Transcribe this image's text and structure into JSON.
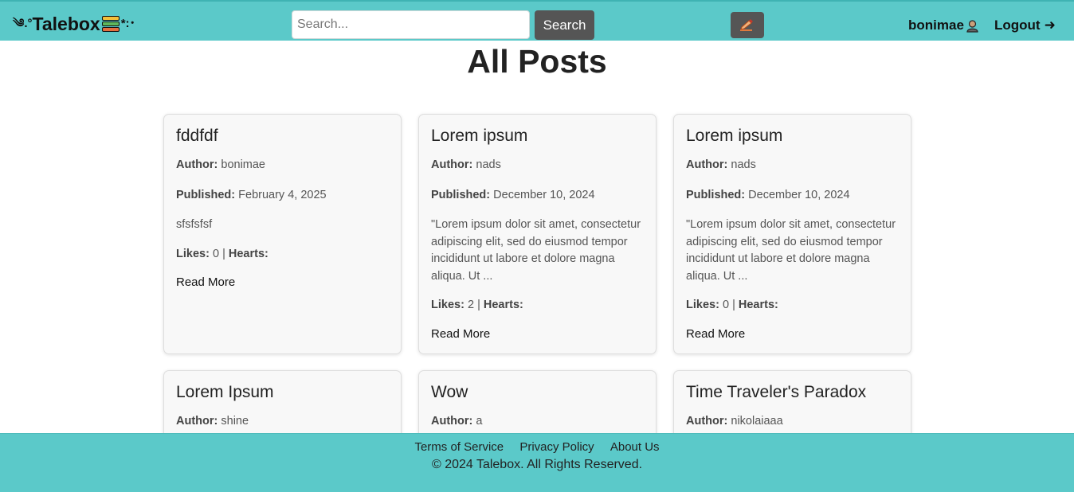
{
  "navbar": {
    "brand_prefix": "༄.°",
    "brand_name": "Talebox",
    "brand_suffix": "*:･",
    "search_placeholder": "Search...",
    "search_value": "",
    "search_label": "Search",
    "username": "bonimae",
    "logout_label": "Logout",
    "logout_arrow": "➜"
  },
  "main": {
    "title": "All Posts",
    "labels": {
      "author": "Author:",
      "published": "Published:",
      "likes": "Likes:",
      "hearts": "Hearts:",
      "read_more": "Read More",
      "separator": "|"
    },
    "posts": [
      {
        "title": "fddfdf",
        "author": "bonimae",
        "published": "February 4, 2025",
        "excerpt": "sfsfsfsf",
        "likes": "0",
        "hearts": ""
      },
      {
        "title": "Lorem ipsum",
        "author": "nads",
        "published": "December 10, 2024",
        "excerpt": "\"Lorem ipsum dolor sit amet, consectetur adipiscing elit, sed do eiusmod tempor incididunt ut labore et dolore magna aliqua. Ut ...",
        "likes": "2",
        "hearts": ""
      },
      {
        "title": "Lorem ipsum",
        "author": "nads",
        "published": "December 10, 2024",
        "excerpt": "\"Lorem ipsum dolor sit amet, consectetur adipiscing elit, sed do eiusmod tempor incididunt ut labore et dolore magna aliqua. Ut ...",
        "likes": "0",
        "hearts": ""
      },
      {
        "title": "Lorem Ipsum",
        "author": "shine"
      },
      {
        "title": "Wow",
        "author": "a"
      },
      {
        "title": "Time Traveler's Paradox",
        "author": "nikolaiaaa"
      }
    ]
  },
  "footer": {
    "links": [
      "Terms of Service",
      "Privacy Policy",
      "About Us"
    ],
    "copyright": "© 2024 Talebox. All Rights Reserved."
  },
  "colors": {
    "navbar_bg": "#5bc9c9",
    "button_bg": "#555555",
    "card_bg": "#f8f8f8"
  },
  "icons": {
    "brand_books": "books-icon",
    "write": "pencil-writing-icon",
    "user": "user-avatar-icon"
  }
}
